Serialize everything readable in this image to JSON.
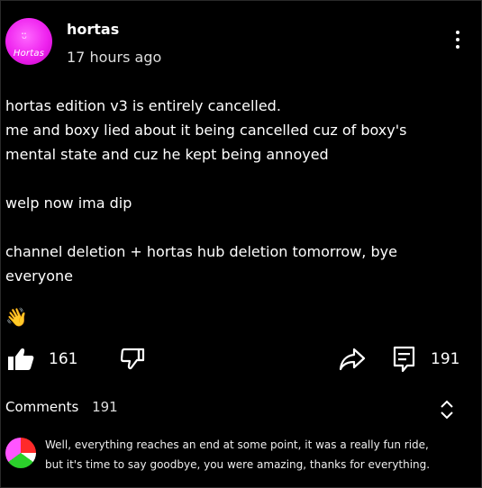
{
  "post": {
    "author": "hortas",
    "time": "17 hours ago",
    "avatar_label": "Hortas",
    "avatar_face": "ᵕ̈",
    "body": {
      "line1": "hortas edition v3 is entirely cancelled.",
      "line2": "me and boxy lied about it being cancelled cuz of boxy's",
      "line3": "mental state and cuz he kept being annoyed",
      "line4": "welp now ima dip",
      "line5": "channel deletion + hortas hub deletion tomorrow, bye",
      "line6": "everyone",
      "emoji": "👋"
    },
    "likes": "161",
    "comment_count": "191"
  },
  "comments": {
    "header_label": "Comments",
    "header_count": "191",
    "first": {
      "line1": "Well, everything reaches an end at some point, it was a really fun ride,",
      "line2": "but it's time to say goodbye, you were amazing, thanks for everything."
    }
  },
  "icons": {
    "like": "thumbs-up-icon",
    "dislike": "thumbs-down-icon",
    "share": "share-icon",
    "comment": "comment-icon",
    "more": "more-vertical-icon",
    "sort": "sort-icon"
  },
  "colors": {
    "background": "#000000",
    "text": "#ffffff",
    "avatar": "#ee22ee"
  }
}
